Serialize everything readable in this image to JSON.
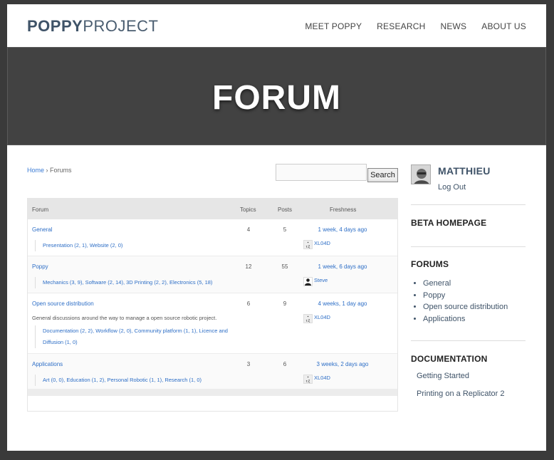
{
  "header": {
    "logo_bold": "POPPY",
    "logo_light": "PROJECT",
    "nav": [
      "MEET POPPY",
      "RESEARCH",
      "NEWS",
      "ABOUT US"
    ]
  },
  "hero": {
    "title": "FORUM"
  },
  "breadcrumb": {
    "home": "Home",
    "separator": " › ",
    "current": "Forums"
  },
  "search": {
    "button_label": "Search",
    "value": ""
  },
  "table": {
    "headers": {
      "forum": "Forum",
      "topics": "Topics",
      "posts": "Posts",
      "freshness": "Freshness"
    },
    "rows": [
      {
        "name": "General",
        "topics": "4",
        "posts": "5",
        "freshness": "1 week, 4 days ago",
        "author": "XL04D",
        "description": "",
        "subforums_line1": "Presentation (2, 1), Website (2, 0)",
        "subforums_line2": ""
      },
      {
        "name": "Poppy",
        "topics": "12",
        "posts": "55",
        "freshness": "1 week, 6 days ago",
        "author": "Steve",
        "description": "",
        "subforums_line1": "Mechanics (3, 9), Software (2, 14), 3D Printing (2, 2), Electronics (5, 18)",
        "subforums_line2": ""
      },
      {
        "name": "Open source distribution",
        "topics": "6",
        "posts": "9",
        "freshness": "4 weeks, 1 day ago",
        "author": "XL04D",
        "description": "General discussions around the way to manage a open source robotic project.",
        "subforums_line1": "Documentation (2, 2), Workflow (2, 0), Community platform (1, 1), Licence and",
        "subforums_line2": "Diffusion (1, 0)"
      },
      {
        "name": "Applications",
        "topics": "3",
        "posts": "6",
        "freshness": "3 weeks, 2 days ago",
        "author": "XL04D",
        "description": "",
        "subforums_line1": "Art (0, 0), Education (1, 2), Personal Robotic (1, 1), Research (1, 0)",
        "subforums_line2": ""
      }
    ]
  },
  "sidebar": {
    "username": "MATTHIEU",
    "logout": "Log Out",
    "beta_title": "BETA HOMEPAGE",
    "forums_title": "FORUMS",
    "forums": [
      "General",
      "Poppy",
      "Open source distribution",
      "Applications"
    ],
    "doc_title": "DOCUMENTATION",
    "docs": [
      "Getting Started",
      "Printing on a Replicator 2"
    ]
  },
  "colors": {
    "brand": "#3f5368",
    "link": "#2d6ec6",
    "hero_bg": "#424242"
  }
}
